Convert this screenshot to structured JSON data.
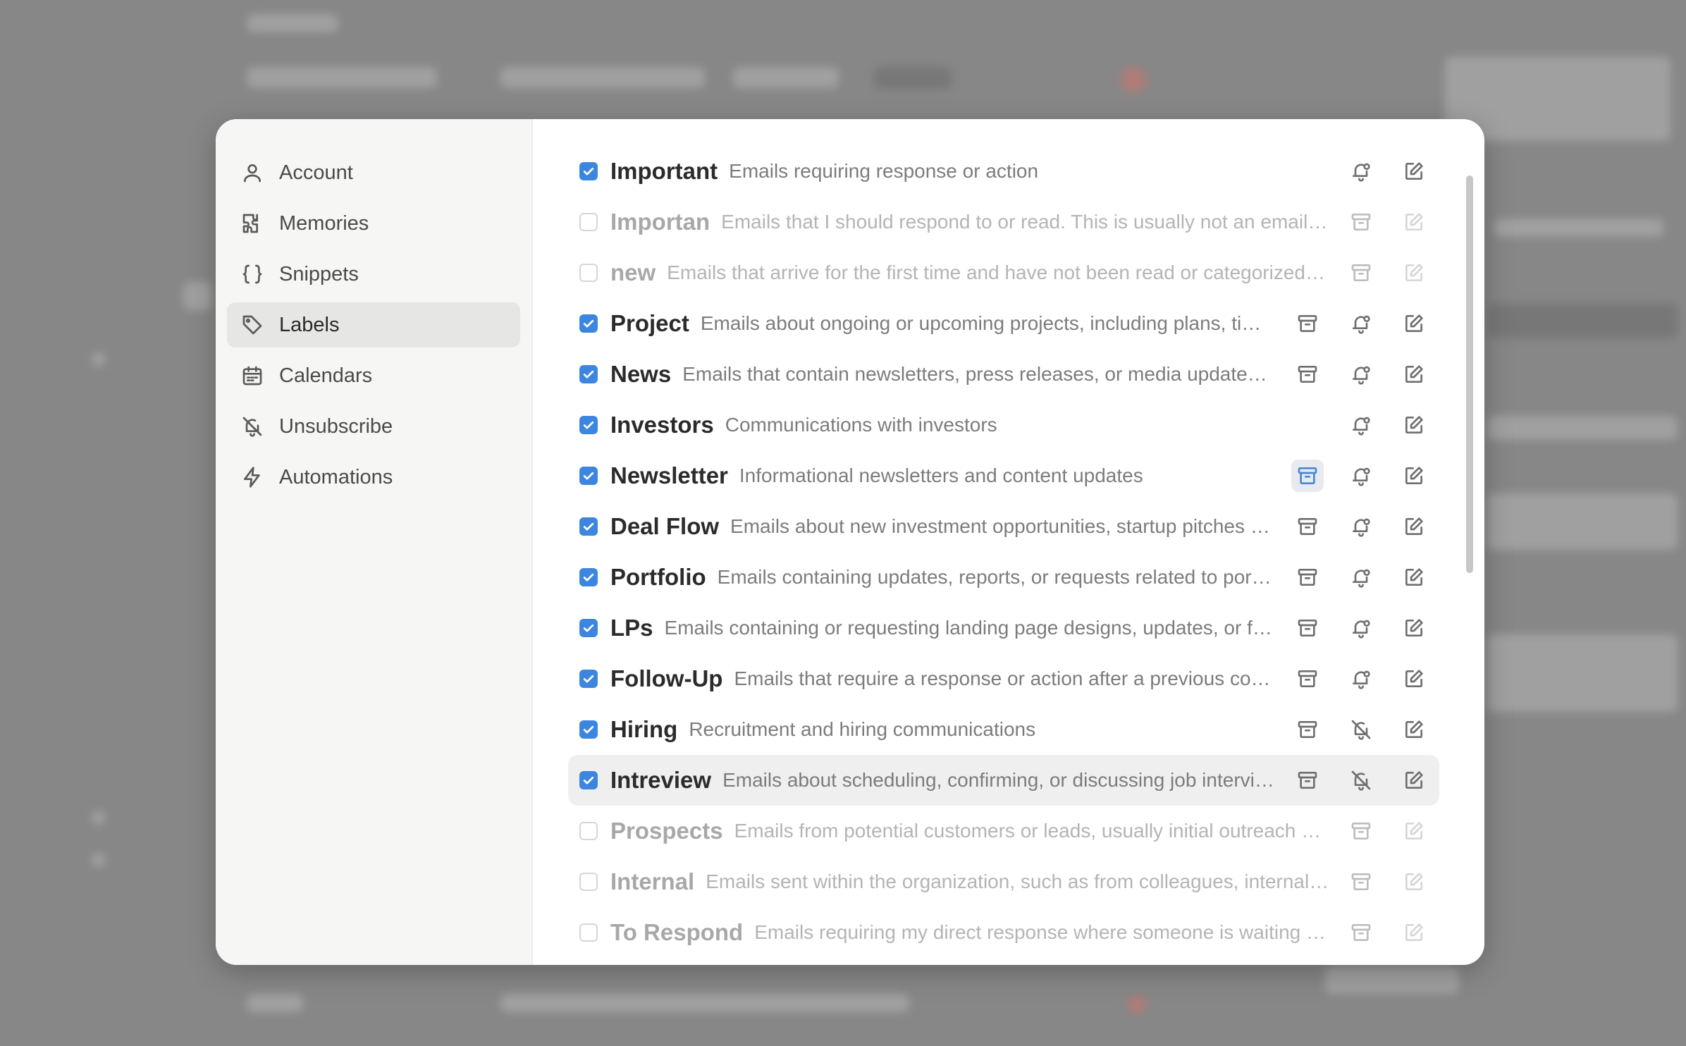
{
  "sidebar": {
    "items": [
      {
        "label": "Account",
        "icon": "user-icon",
        "active": false
      },
      {
        "label": "Memories",
        "icon": "puzzle-icon",
        "active": false
      },
      {
        "label": "Snippets",
        "icon": "braces-icon",
        "active": false
      },
      {
        "label": "Labels",
        "icon": "tag-icon",
        "active": true
      },
      {
        "label": "Calendars",
        "icon": "calendar-icon",
        "active": false
      },
      {
        "label": "Unsubscribe",
        "icon": "bell-off-icon",
        "active": false
      },
      {
        "label": "Automations",
        "icon": "lightning-icon",
        "active": false
      }
    ]
  },
  "labels": [
    {
      "name": "Important",
      "description": "Emails requiring response or action",
      "enabled": true,
      "archive": false,
      "bell": "bell-dot"
    },
    {
      "name": "Importan",
      "description": "Emails that I should respond to or read. This is usually not an email that is an update or a notification",
      "enabled": false,
      "archive": true,
      "bell": "none"
    },
    {
      "name": "new",
      "description": "Emails that arrive for the first time and have not been read or categorized yet",
      "enabled": false,
      "archive": true,
      "bell": "none"
    },
    {
      "name": "Project",
      "description": "Emails about ongoing or upcoming projects, including plans, timelines and deliverables",
      "enabled": true,
      "archive": true,
      "bell": "bell-dot"
    },
    {
      "name": "News",
      "description": "Emails that contain newsletters, press releases, or media updates and announcements",
      "enabled": true,
      "archive": true,
      "bell": "bell-dot"
    },
    {
      "name": "Investors",
      "description": "Communications with investors",
      "enabled": true,
      "archive": false,
      "bell": "bell-dot"
    },
    {
      "name": "Newsletter",
      "description": "Informational newsletters and content updates",
      "enabled": true,
      "archive": true,
      "archive_active": true,
      "bell": "bell-dot"
    },
    {
      "name": "Deal Flow",
      "description": "Emails about new investment opportunities, startup pitches and introductions",
      "enabled": true,
      "archive": true,
      "bell": "bell-dot"
    },
    {
      "name": "Portfolio",
      "description": "Emails containing updates, reports, or requests related to portfolio companies",
      "enabled": true,
      "archive": true,
      "bell": "bell-dot"
    },
    {
      "name": "LPs",
      "description": "Emails containing or requesting landing page designs, updates, or feedback",
      "enabled": true,
      "archive": true,
      "bell": "bell-dot"
    },
    {
      "name": "Follow-Up",
      "description": "Emails that require a response or action after a previous conversation",
      "enabled": true,
      "archive": true,
      "bell": "bell-dot"
    },
    {
      "name": "Hiring",
      "description": "Recruitment and hiring communications",
      "enabled": true,
      "archive": true,
      "bell": "bell-off"
    },
    {
      "name": "Intreview",
      "description": "Emails about scheduling, confirming, or discussing job interviews with candidates",
      "enabled": true,
      "archive": true,
      "bell": "bell-off",
      "hover": true
    },
    {
      "name": "Prospects",
      "description": "Emails from potential customers or leads, usually initial outreach or follow ups",
      "enabled": false,
      "archive": true,
      "bell": "none"
    },
    {
      "name": "Internal",
      "description": "Emails sent within the organization, such as from colleagues, internal teams or managers",
      "enabled": false,
      "archive": true,
      "bell": "none"
    },
    {
      "name": "To Respond",
      "description": "Emails requiring my direct response where someone is waiting on me",
      "enabled": false,
      "archive": true,
      "bell": "none"
    }
  ],
  "colors": {
    "accent": "#3d86e0",
    "sidebar_bg": "#f6f6f5",
    "active_nav": "#e6e6e5"
  }
}
